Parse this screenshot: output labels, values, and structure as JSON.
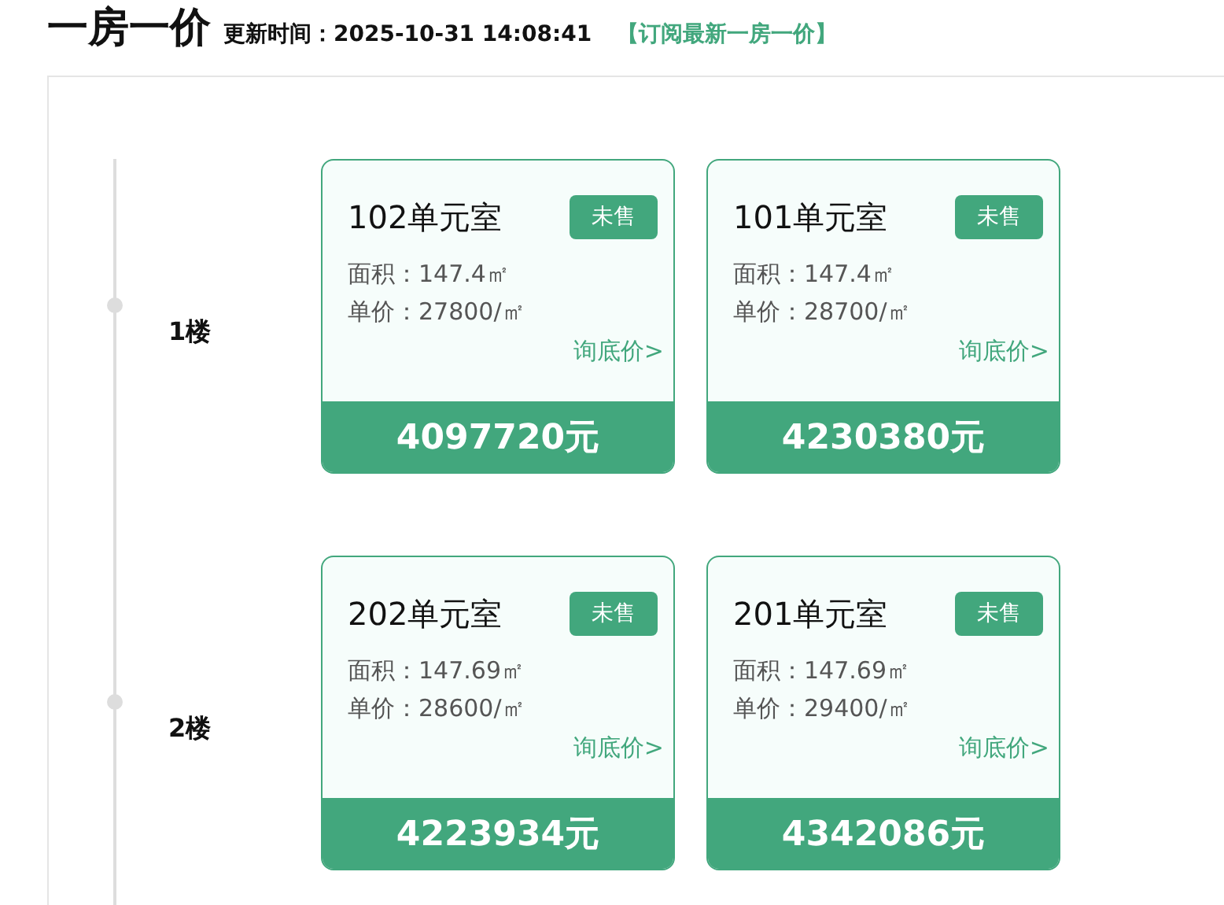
{
  "header": {
    "title": "一房一价",
    "updated": "更新时间：2025-10-31 14:08:41",
    "subscribe_link": "【订阅最新一房一价】"
  },
  "floors": [
    {
      "label": "1楼",
      "units": [
        {
          "name": "102单元室",
          "status": "未售",
          "area": "面积：147.4㎡",
          "unit_price": "单价：27800/㎡",
          "inquiry_link": "询底价>",
          "total": "4097720元"
        },
        {
          "name": "101单元室",
          "status": "未售",
          "area": "面积：147.4㎡",
          "unit_price": "单价：28700/㎡",
          "inquiry_link": "询底价>",
          "total": "4230380元"
        }
      ]
    },
    {
      "label": "2楼",
      "units": [
        {
          "name": "202单元室",
          "status": "未售",
          "area": "面积：147.69㎡",
          "unit_price": "单价：28600/㎡",
          "inquiry_link": "询底价>",
          "total": "4223934元"
        },
        {
          "name": "201单元室",
          "status": "未售",
          "area": "面积：147.69㎡",
          "unit_price": "单价：29400/㎡",
          "inquiry_link": "询底价>",
          "total": "4342086元"
        }
      ]
    }
  ]
}
